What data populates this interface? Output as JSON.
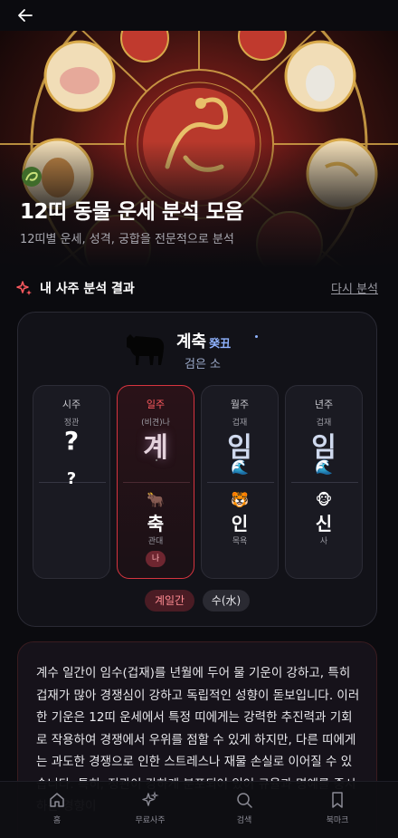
{
  "hero": {
    "title": "12띠 동물 운세 분석 모음",
    "subtitle": "12띠별 운세, 성격, 궁합을 전문적으로 분석"
  },
  "section": {
    "title": "내 사주 분석 결과",
    "retry_label": "다시 분석"
  },
  "animal": {
    "name": "계축",
    "hanja": "癸丑",
    "description": "검은 소"
  },
  "pillars": [
    {
      "head": "시주",
      "tag": "정관",
      "stem": "?",
      "branch": "?"
    },
    {
      "head": "일주",
      "tag": "(비견)나",
      "stem": "계",
      "branch_emoji": "🐂",
      "branch": "축",
      "relation": "관대",
      "me_badge": "나"
    },
    {
      "head": "월주",
      "tag": "겁재",
      "stem": "임",
      "stem_emoji": "🌊",
      "branch_emoji": "🐯",
      "branch": "인",
      "relation": "목욕"
    },
    {
      "head": "년주",
      "tag": "겁재",
      "stem": "임",
      "stem_emoji": "🌊",
      "branch_emoji": "🐵",
      "branch": "신",
      "relation": "사"
    }
  ],
  "chips": {
    "day_stem": "계일간",
    "element": "수(水)"
  },
  "analysis": {
    "text": "계수 일간이 임수(겁재)를 년월에 두어 물 기운이 강하고, 특히 겁재가 많아 경쟁심이 강하고 독립적인 성향이 돋보입니다. 이러한 기운은 12띠 운세에서 특정 띠에게는 강력한 추진력과 기회로 작용하여 경쟁에서 우위를 점할 수 있게 하지만, 다른 띠에게는 과도한 경쟁으로 인한 스트레스나 재물 손실로 이어질 수 있습니다. 특히, 정관이 강하게 분포되어 있어 규율과 명예를 중시하는 경향이"
  },
  "nav": {
    "items": [
      {
        "label": "홈",
        "icon": "home-icon"
      },
      {
        "label": "무료사주",
        "icon": "sparkles-icon"
      },
      {
        "label": "검색",
        "icon": "search-icon"
      },
      {
        "label": "북마크",
        "icon": "bookmark-icon"
      }
    ]
  },
  "colors": {
    "background": "#0b0b0f",
    "accent_red": "#d6343f",
    "stem_blue": "#cfd9ee",
    "hanja_blue": "#8fb3ff"
  }
}
